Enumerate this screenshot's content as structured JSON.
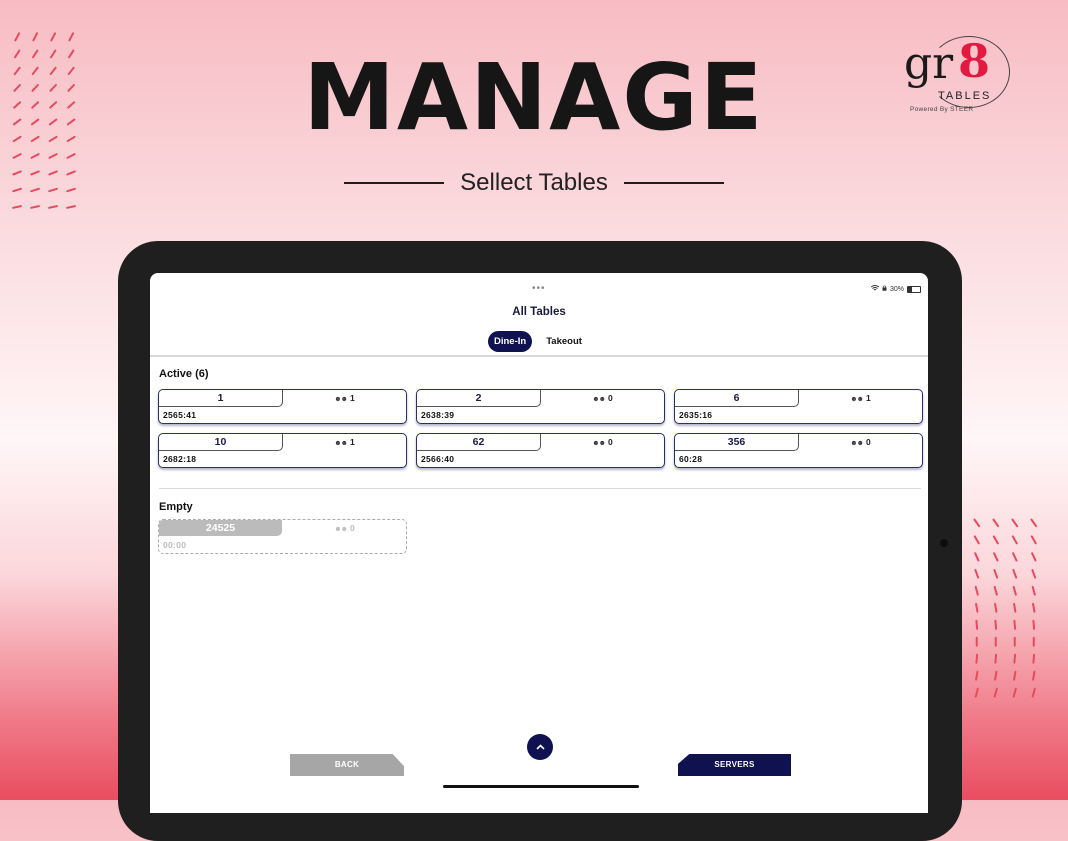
{
  "marketing": {
    "headline": "MANAGE",
    "subheadline": "Sellect Tables"
  },
  "logo": {
    "mark_gr": "gr",
    "mark_8": "8",
    "word": "TABLES",
    "powered": "Powered By STEER"
  },
  "status_bar": {
    "battery": "30%"
  },
  "app": {
    "title": "All Tables",
    "tabs": [
      {
        "label": "Dine-In",
        "active": true
      },
      {
        "label": "Takeout",
        "active": false
      }
    ],
    "active_section": {
      "label": "Active (6)",
      "tables": [
        {
          "number": "1",
          "guests": "1",
          "time": "2565:41"
        },
        {
          "number": "2",
          "guests": "0",
          "time": "2638:39"
        },
        {
          "number": "6",
          "guests": "1",
          "time": "2635:16"
        },
        {
          "number": "10",
          "guests": "1",
          "time": "2682:18"
        },
        {
          "number": "62",
          "guests": "0",
          "time": "2566:40"
        },
        {
          "number": "356",
          "guests": "0",
          "time": "60:28"
        }
      ]
    },
    "empty_section": {
      "label": "Empty",
      "tables": [
        {
          "number": "24525",
          "guests": "0",
          "time": "00:00"
        }
      ]
    },
    "footer": {
      "back_label": "BACK",
      "servers_label": "SERVERS",
      "fab_icon": "chevron-up-icon"
    }
  },
  "colors": {
    "navy": "#0f1150",
    "accent_red": "#e3193f",
    "empty_gray": "#bbbbbb"
  }
}
